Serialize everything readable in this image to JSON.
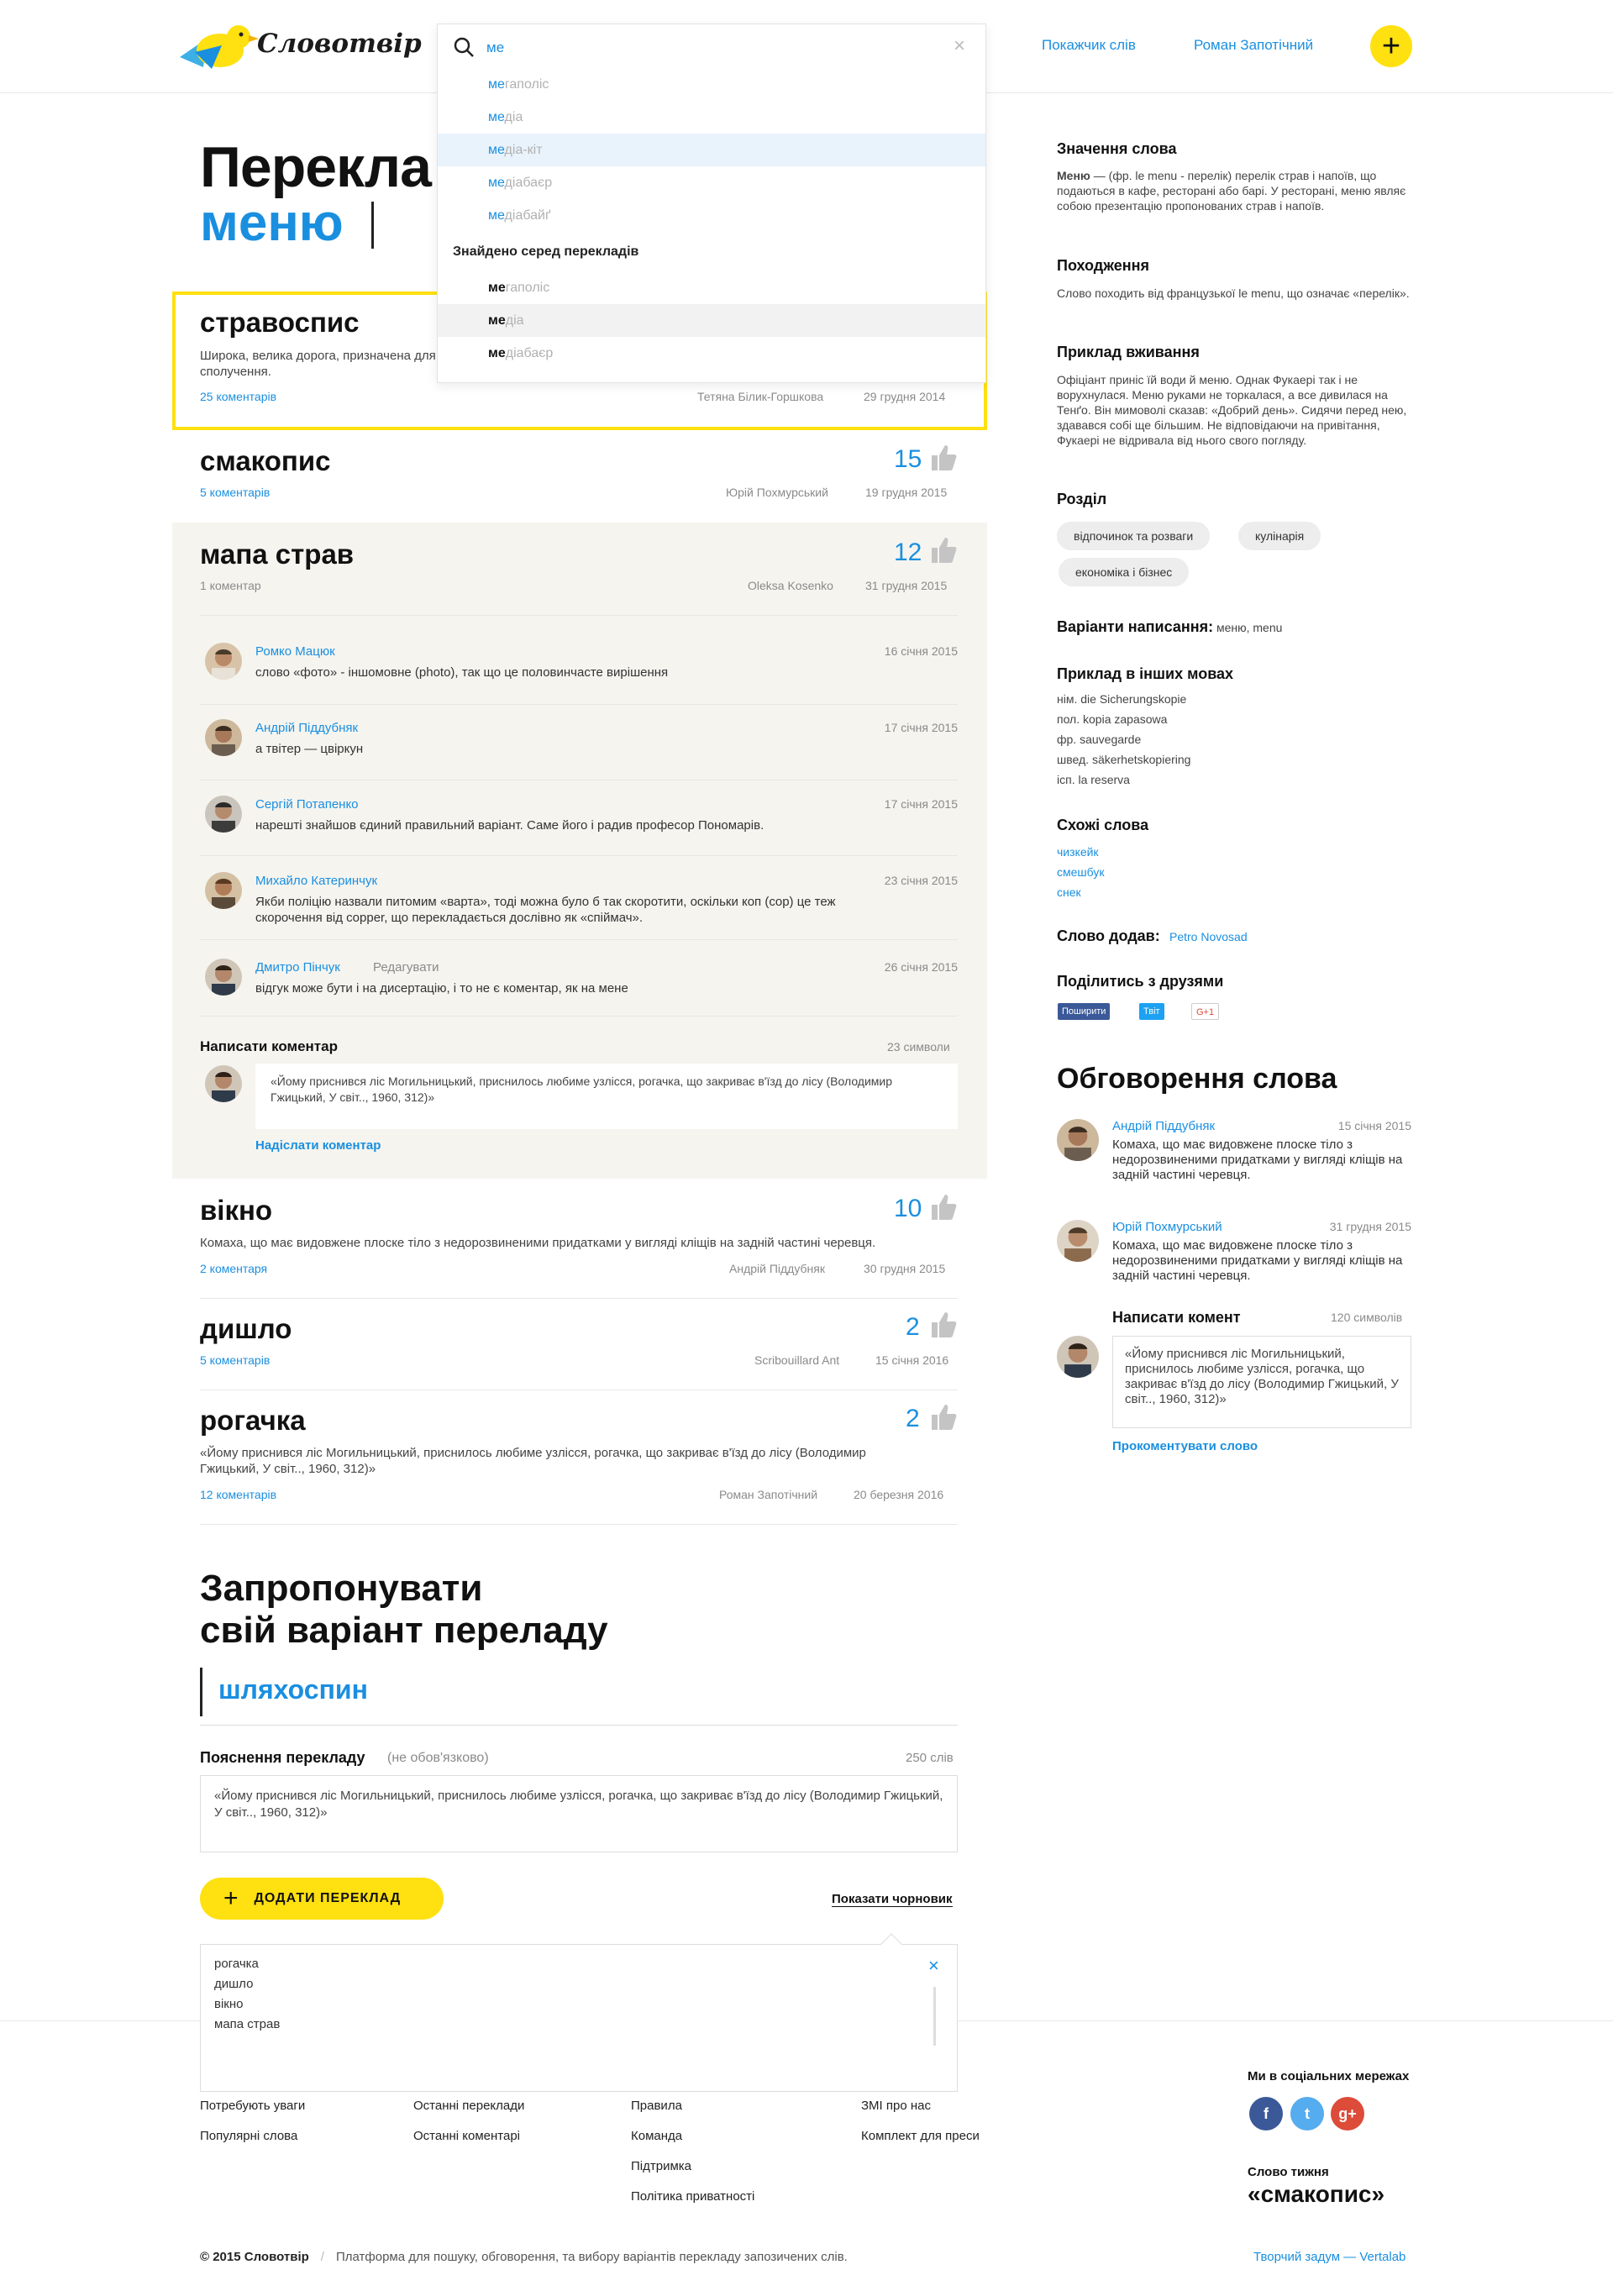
{
  "header": {
    "logo_text": "Словотвір",
    "nav_index": "Покажчик слів",
    "nav_user": "Роман Запотічний",
    "add_symbol": "+"
  },
  "search": {
    "query": "ме",
    "suggestions": [
      {
        "match": "ме",
        "rest": "гаполіс"
      },
      {
        "match": "ме",
        "rest": "діа"
      },
      {
        "match": "ме",
        "rest": "діа-кіт"
      },
      {
        "match": "ме",
        "rest": "діабаєр"
      },
      {
        "match": "ме",
        "rest": "діабайґ"
      }
    ],
    "found_title": "Знайдено серед перекладів",
    "found": [
      {
        "match": "ме",
        "rest": "гаполіс"
      },
      {
        "match": "ме",
        "rest": "діа"
      },
      {
        "match": "ме",
        "rest": "діабаєр"
      }
    ]
  },
  "page": {
    "title": "Перекла",
    "word": "меню"
  },
  "translations": [
    {
      "word": "стравоспис",
      "desc": "Широка, велика дорога, призначена для сполучення.",
      "comments": "25 коментарів",
      "author": "Тетяна Білик-Горшкова",
      "date": "29 грудня 2014",
      "votes": ""
    },
    {
      "word": "смакопис",
      "desc": "",
      "comments": "5 коментарів",
      "author": "Юрій Похмурський",
      "date": "19 грудня 2015",
      "votes": "15"
    },
    {
      "word": "мапа страв",
      "desc": "",
      "comments": "1 коментар",
      "author": "Oleksa Kosenko",
      "date": "31 грудня 2015",
      "votes": "12"
    },
    {
      "word": "вікно",
      "desc": "Комаха, що має видовжене плоске тіло з недорозвиненими придатками у вигляді кліщів на задній частині черевця.",
      "comments": "2 коментаря",
      "author": "Андрій Піддубняк",
      "date": "30 грудня 2015",
      "votes": "10"
    },
    {
      "word": "дишло",
      "desc": "",
      "comments": "5 коментарів",
      "author": "Scribouillard Ant",
      "date": "15 січня 2016",
      "votes": "2"
    },
    {
      "word": "рогачка",
      "desc": "«Йому приснився ліс Могильницький, приснилось любиме узлісся, рогачка, що закриває в'їзд до лісу (Володимир Гжицький, У світ.., 1960, 312)»",
      "comments": "12 коментарів",
      "author": "Роман Запотічний",
      "date": "20 березня 2016",
      "votes": "2"
    }
  ],
  "comments": [
    {
      "name": "Ромко Мацюк",
      "date": "16 січня 2015",
      "text": "слово «фото» - іншомовне (photo), так що це половинчасте вирішення"
    },
    {
      "name": "Андрій Піддубняк",
      "date": "17 січня 2015",
      "text": "а твітер — цвіркун"
    },
    {
      "name": "Сергій Потапенко",
      "date": "17 січня 2015",
      "text": "нарешті знайшов єдиний правильний варіант. Саме його і радив професор Пономарів."
    },
    {
      "name": "Михайло Катеринчук",
      "date": "23 січня 2015",
      "text": "Якби поліцію назвали питомим «варта», тоді можна було б так скоротити, оскільки коп (cop) це теж скорочення від copper, що перекладається дослівно як «спіймач»."
    },
    {
      "name": "Дмитро Пінчук",
      "edit": "Редагувати",
      "date": "26 січня 2015",
      "text": "відгук може бути і на дисертацію, і то не є коментар, як на мене"
    }
  ],
  "write_comment": {
    "label": "Написати коментар",
    "count": "23 символи",
    "text": "«Йому приснився ліс Могильницький, приснилось любиме узлісся, рогачка, що закриває в'їзд до лісу (Володимир Гжицький, У світ.., 1960, 312)»",
    "send": "Надіслати коментар"
  },
  "suggest": {
    "title_line1": "Запропонувати",
    "title_line2": "свій варіант переладу",
    "word": "шляхоспин",
    "expl_label": "Пояснення перекладу",
    "expl_optional": "(не обов'язково)",
    "expl_count": "250 слів",
    "expl_text": "«Йому приснився ліс Могильницький, приснилось любиме узлісся, рогачка, що закриває в'їзд до лісу (Володимир Гжицький, У світ.., 1960, 312)»",
    "add_button": "ДОДАТИ ПЕРЕКЛАД",
    "show_draft": "Показати чорновик",
    "drafts": [
      "рогачка",
      "дишло",
      "вікно",
      "мапа страв"
    ]
  },
  "sidebar": {
    "meaning_title": "Значення слова",
    "meaning_word": "Меню",
    "meaning_text": " — (фр. le menu - перелік) перелік страв і напоїв, що подаються в кафе, ресторані або барі. У ресторані, меню являє собою презентацію пропонованих страв і напоїв.",
    "origin_title": "Походження",
    "origin_text": "Слово походить від французької le menu, що означає «перелік».",
    "example_title": "Приклад вживання",
    "example_text": "Офіціант приніс їй води й меню. Однак Фукаері так і не ворухнулася. Меню руками не торкалася, а все дивилася на Тенґо. Він мимоволі сказав: «Добрий день». Сидячи перед нею, здавався собі ще більшим. Не відповідаючи на привітання, Фукаері не відривала від нього свого погляду.",
    "section_title": "Розділ",
    "tags": [
      "відпочинок та розваги",
      "кулінарія",
      "економіка і бізнес"
    ],
    "variants_label": "Варіанти написання:",
    "variants_value": " меню, menu",
    "other_lang_title": "Приклад в інших мовах",
    "other_lang": [
      "нім. die Sicherungskopie",
      "пол. kopia zapasowa",
      "фр. sauvegarde",
      "швед. säkerhetskopiering",
      "ісп. la reserva"
    ],
    "similar_title": "Схожі слова",
    "similar": [
      "чизкейк",
      "смешбук",
      "снек"
    ],
    "added_label": "Слово додав:",
    "added_by": "Petro Novosad",
    "share_title": "Поділитись з друзями",
    "share_fb": "Поширити",
    "share_tw": "Твіт",
    "share_gp": "G+1",
    "discuss_title": "Обговорення слова",
    "discussions": [
      {
        "name": "Андрій Піддубняк",
        "date": "15 січня 2015",
        "text": "Комаха, що має видовжене плоске тіло з недорозвиненими придатками у вигляді кліщів на задній частині черевця."
      },
      {
        "name": "Юрій Похмурський",
        "date": "31 грудня 2015",
        "text": "Комаха, що має видовжене плоске тіло з недорозвиненими придатками у вигляді кліщів на задній частині черевця."
      }
    ],
    "write_label": "Написати комент",
    "write_count": "120 символів",
    "write_text": "«Йому приснився ліс Могильницький, приснилось любиме узлісся, рогачка, що закриває в'їзд до лісу (Володимир Гжицький, У світ.., 1960, 312)»",
    "write_send": "Прокоментувати слово"
  },
  "footer": {
    "col1": [
      "Потребують уваги",
      "Популярні слова"
    ],
    "col2": [
      "Останні переклади",
      "Останні коментарі"
    ],
    "col3": [
      "Правила",
      "Команда",
      "Підтримка",
      "Політика приватності"
    ],
    "col4": [
      "ЗМІ про нас",
      "Комплект для преси"
    ],
    "social_title": "Ми в соціальних мережах",
    "social": [
      "f",
      "t",
      "g+"
    ],
    "wotw_label": "Слово тижня",
    "wotw_word": "«смакопис»",
    "copyright": "© 2015 Словотвір",
    "tagline": "Платформа для пошуку, обговорення, та вибору варіантів перекладу запозичених слів.",
    "credits": "Творчий задум — Vertalab"
  },
  "colors": {
    "accent": "#1a8fe0",
    "yellow": "#ffe011",
    "panel": "#f5f4ef"
  }
}
